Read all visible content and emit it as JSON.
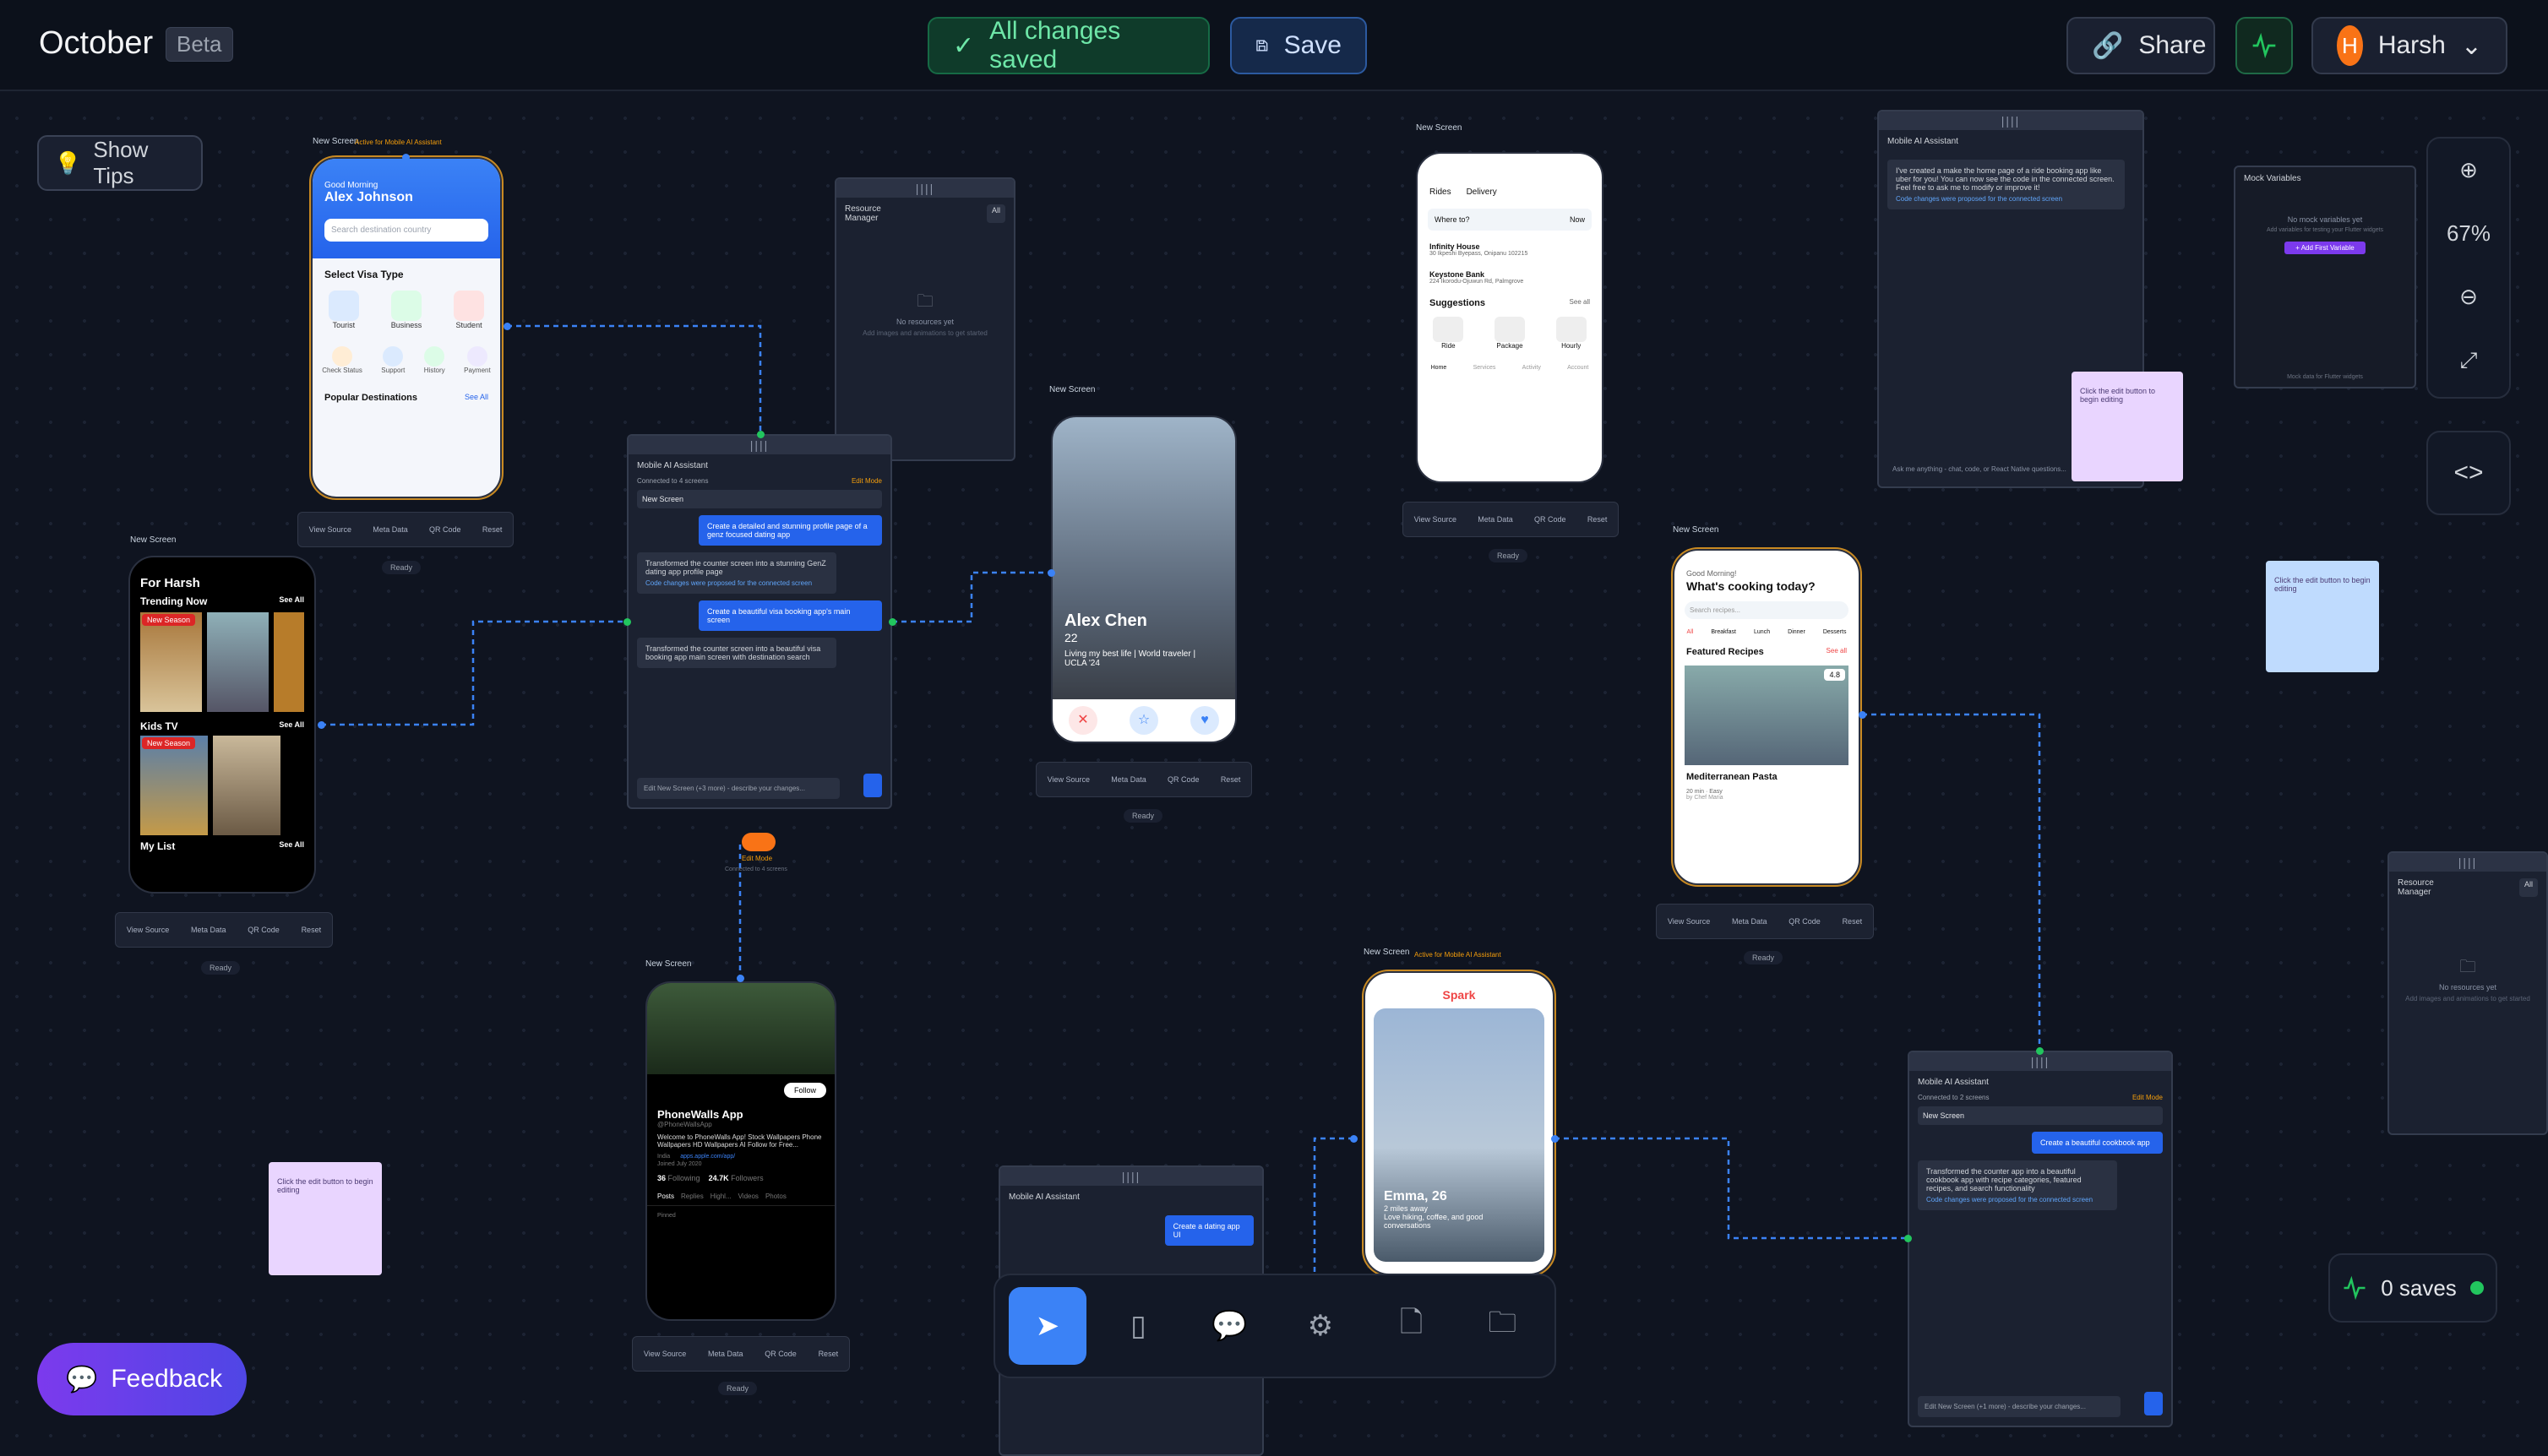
{
  "header": {
    "brand": "October",
    "beta": "Beta",
    "saved_status": "All changes saved",
    "save": "Save",
    "share": "Share",
    "user_initial": "H",
    "user_name": "Harsh"
  },
  "canvas": {
    "show_tips": "Show Tips",
    "zoom": "67%",
    "saves": "0 saves",
    "feedback": "Feedback"
  },
  "labels": {
    "new_screen": "New Screen",
    "active_for": "Active for Mobile AI Assistant",
    "view_source": "View Source",
    "meta_data": "Meta Data",
    "qr_code": "QR Code",
    "reset": "Reset",
    "ready": "Ready",
    "edit_mode": "Edit Mode",
    "connected_4": "Connected to 4 screens"
  },
  "visa_app": {
    "greeting": "Good Morning",
    "name": "Alex Johnson",
    "search": "Search destination country",
    "section": "Select Visa Type",
    "types": [
      "Tourist",
      "Business",
      "Student"
    ],
    "actions": [
      "Check Status",
      "Support",
      "History",
      "Payment"
    ],
    "popular": "Popular Destinations",
    "see_all": "See All"
  },
  "tv_app": {
    "title": "For Harsh",
    "trending": "Trending Now",
    "see_all": "See All",
    "badge": "New Season",
    "kids": "Kids TV",
    "mylist": "My List"
  },
  "resource_manager": {
    "title": "Resource Manager",
    "filter": "All",
    "empty": "No resources yet",
    "hint": "Add images and animations to get started"
  },
  "ai_assistant_1": {
    "title": "Mobile AI Assistant",
    "connected": "Connected to 4 screens",
    "edit_mode": "Edit Mode",
    "target": "New Screen",
    "msg_user_1": "Create a detailed and stunning profile page of a genz focused dating app",
    "msg_ai_1": "Transformed the counter screen into a stunning GenZ dating app profile page",
    "msg_ai_1_note": "Code changes were proposed for the connected screen",
    "msg_user_2": "Create a beautiful visa booking app's main screen",
    "msg_ai_2": "Transformed the counter screen into a beautiful visa booking app main screen with destination search",
    "input": "Edit New Screen (+3 more) - describe your changes..."
  },
  "profile_app": {
    "name": "Alex Chen",
    "age": "22",
    "bio": "Living my best life | World traveler | UCLA '24"
  },
  "rides_app": {
    "tabs": [
      "Rides",
      "Delivery"
    ],
    "where": "Where to?",
    "now": "Now",
    "places": [
      {
        "name": "Infinity House",
        "addr": "30 Ikpeshi Byepass, Onipanu 102215"
      },
      {
        "name": "Keystone Bank",
        "addr": "224 Ikorodu-Ojuwun Rd, Palmgrove"
      }
    ],
    "suggestions": "Suggestions",
    "see_all": "See all",
    "options": [
      "Ride",
      "Package",
      "Hourly"
    ],
    "nav": [
      "Home",
      "Services",
      "Activity",
      "Account"
    ]
  },
  "ai_assistant_2": {
    "title": "Mobile AI Assistant",
    "msg": "I've created a make the home page of a ride booking app like uber for you! You can now see the code in the connected screen. Feel free to ask me to modify or improve it!",
    "note": "Code changes were proposed for the connected screen",
    "input": "Ask me anything - chat, code, or React Native questions..."
  },
  "mock_vars": {
    "title": "Mock Variables",
    "empty": "No mock variables yet",
    "hint": "Add variables for testing your Flutter widgets",
    "add": "+ Add First Variable",
    "footer": "Mock data for Flutter widgets"
  },
  "notes": {
    "text": "Click the edit button to begin editing"
  },
  "recipe_app": {
    "greeting": "Good Morning!",
    "title": "What's cooking today?",
    "search": "Search recipes...",
    "cats": [
      "All",
      "Breakfast",
      "Lunch",
      "Dinner",
      "Desserts"
    ],
    "featured": "Featured Recipes",
    "see_all": "See all",
    "dish": "Mediterranean Pasta",
    "rating": "4.8",
    "meta": "20 min · Easy",
    "chef": "by Chef Maria"
  },
  "wall_app": {
    "name": "PhoneWalls App",
    "handle": "@PhoneWallsApp",
    "follow": "Follow",
    "bio": "Welcome to PhoneWalls App! Stock Wallpapers Phone Wallpapers HD Wallpapers AI Follow for Free...",
    "location": "India",
    "link": "apps.apple.com/app/",
    "joined": "Joined July 2020",
    "following": "36",
    "following_label": "Following",
    "followers": "24.7K",
    "followers_label": "Followers",
    "tabs": [
      "Posts",
      "Replies",
      "Highl...",
      "Videos",
      "Photos"
    ],
    "pinned": "Pinned"
  },
  "ai_assistant_3": {
    "title": "Mobile AI Assistant",
    "msg": "Create a dating app UI"
  },
  "spark_app": {
    "brand": "Spark",
    "name": "Emma, 26",
    "distance": "2 miles away",
    "bio": "Love hiking, coffee, and good conversations"
  },
  "ai_assistant_4": {
    "title": "Mobile AI Assistant",
    "connected": "Connected to 2 screens",
    "edit_mode": "Edit Mode",
    "target": "New Screen",
    "msg_user": "Create a beautiful cookbook app",
    "msg_ai": "Transformed the counter app into a beautiful cookbook app with recipe categories, featured recipes, and search functionality",
    "note": "Code changes were proposed for the connected screen",
    "input": "Edit New Screen (+1 more) - describe your changes..."
  },
  "colors": {
    "accent": "#3b82f6",
    "success": "#22c55e",
    "selected": "#c98a22"
  }
}
